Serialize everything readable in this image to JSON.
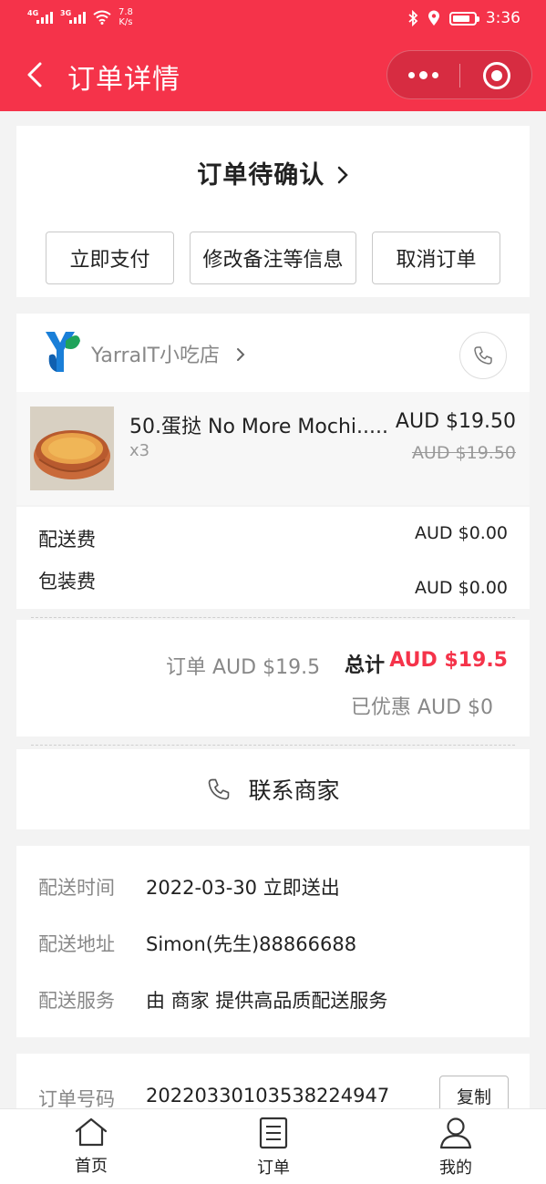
{
  "status_bar": {
    "network1": "4G",
    "network2": "3G",
    "speed_value": "7.8",
    "speed_unit": "K/s",
    "time": "3:36"
  },
  "nav": {
    "title": "订单详情"
  },
  "status": {
    "title": "订单待确认",
    "actions": [
      "立即支付",
      "修改备注等信息",
      "取消订单"
    ]
  },
  "shop": {
    "name": "YarraIT小吃店",
    "item": {
      "name": "50.蛋挞 No More Mochi.....",
      "qty": "x3",
      "price": "AUD $19.50",
      "original_price": "AUD $19.50"
    }
  },
  "fees": {
    "delivery_label": "配送费",
    "delivery_value": "AUD $0.00",
    "packing_label": "包装费",
    "packing_value": "AUD $0.00"
  },
  "totals": {
    "order_amount": "订单 AUD $19.5",
    "total_label": "总计",
    "total_amount": "AUD $19.5",
    "discount": "已优惠 AUD $0"
  },
  "contact": {
    "label": "联系商家"
  },
  "delivery": {
    "rows": [
      {
        "label": "配送时间",
        "value": "2022-03-30 立即送出"
      },
      {
        "label": "配送地址",
        "value": "Simon(先生)88866688"
      },
      {
        "label": "配送服务",
        "value": "由 商家 提供高品质配送服务"
      }
    ]
  },
  "order": {
    "number_label": "订单号码",
    "number_value": "20220330103538224947",
    "copy_label": "复制"
  },
  "tabbar": {
    "items": [
      {
        "label": "首页",
        "icon": "home-icon"
      },
      {
        "label": "订单",
        "icon": "order-list-icon"
      },
      {
        "label": "我的",
        "icon": "user-icon"
      }
    ]
  },
  "colors": {
    "brand": "#f5334a",
    "accent_price": "#f5334a"
  }
}
